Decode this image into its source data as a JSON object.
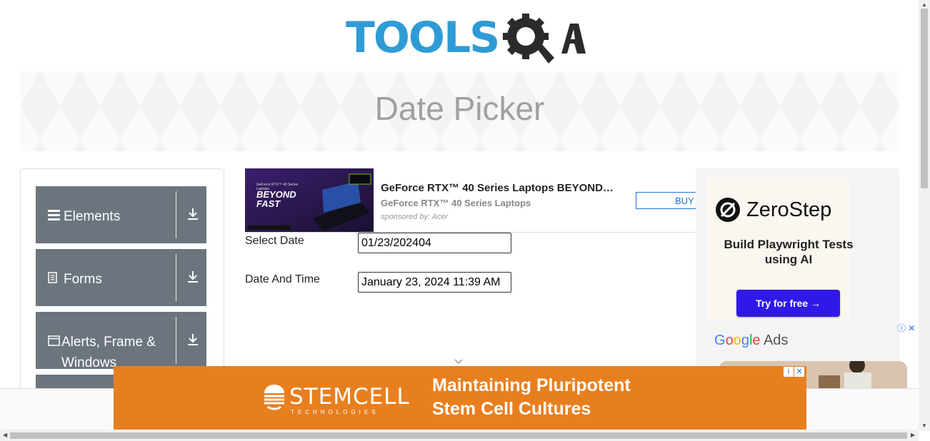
{
  "header": {
    "logo_text": "TOOLSQA"
  },
  "page": {
    "title": "Date Picker"
  },
  "sidebar": {
    "groups": [
      {
        "label": "Elements",
        "icon": "hamburger-icon"
      },
      {
        "label": "Forms",
        "icon": "document-icon"
      },
      {
        "label": "Alerts, Frame & Windows",
        "icon": "window-icon"
      }
    ]
  },
  "ad_top": {
    "title": "GeForce RTX™ 40 Series Laptops BEYOND…",
    "subtitle": "GeForce RTX™ 40 Series Laptops",
    "sponsor": "sponsored by: Acer",
    "button": "BUY",
    "image_heading_line1": "BEYOND",
    "image_heading_line2": "FAST",
    "image_small_text": "GeForce RTX™ 40 Series Laptops"
  },
  "form": {
    "select_date_label": "Select Date",
    "select_date_value": "01/23/202404",
    "date_time_label": "Date And Time",
    "date_time_value": "January 23, 2024 11:39 AM"
  },
  "ad_right": {
    "brand": "ZeroStep",
    "headline": "Build Playwright Tests using AI",
    "cta": "Try for free →",
    "google_label": "Google",
    "ads_label": "Ads"
  },
  "ad_bottom": {
    "brand": "STEMCELL",
    "brand_sub": "TECHNOLOGIES",
    "line1": "Maintaining Pluripotent",
    "line2": "Stem Cell Cultures"
  },
  "colors": {
    "logo_blue": "#2f9bd6",
    "sidebar_gray": "#6c757d",
    "stemcell_orange": "#e87f1f",
    "zerostep_button": "#3019e8"
  }
}
